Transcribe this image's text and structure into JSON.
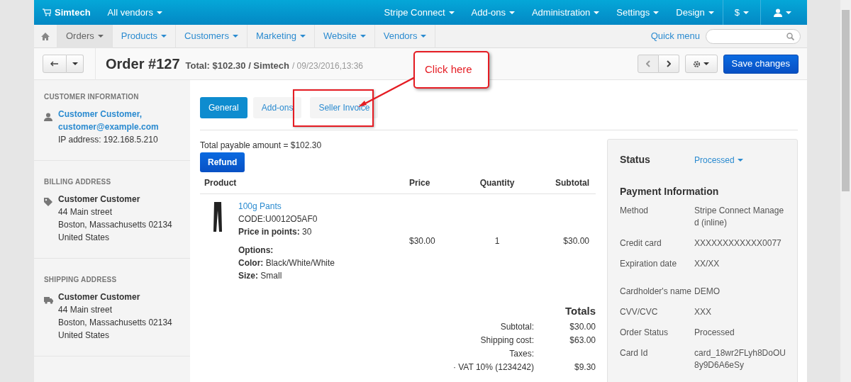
{
  "topbar": {
    "brand": "Simtech",
    "vendor_menu": "All vendors",
    "menus": [
      {
        "label": "Stripe Connect"
      },
      {
        "label": "Add-ons"
      },
      {
        "label": "Administration"
      },
      {
        "label": "Settings"
      },
      {
        "label": "Design"
      },
      {
        "label": "$",
        "kind": "boxed"
      }
    ]
  },
  "subnav": {
    "items": [
      {
        "label": "Orders",
        "selected": true
      },
      {
        "label": "Products",
        "selected": false
      },
      {
        "label": "Customers",
        "selected": false
      },
      {
        "label": "Marketing",
        "selected": false
      },
      {
        "label": "Website",
        "selected": false
      },
      {
        "label": "Vendors",
        "selected": false
      }
    ],
    "quick_menu": "Quick menu"
  },
  "toolbar": {
    "title": "Order #127",
    "summary": "Total: $102.30 / Simtech",
    "date": "/ 09/23/2016,13:36",
    "save": "Save changes"
  },
  "sidebar": [
    {
      "heading": "CUSTOMER INFORMATION",
      "kind": "person",
      "lines": [
        {
          "text": "Customer Customer,",
          "kind": "link"
        },
        {
          "text": "customer@example.com",
          "kind": "link"
        },
        {
          "text": "IP address: 192.168.5.210",
          "kind": "plain"
        }
      ]
    },
    {
      "heading": "BILLING ADDRESS",
      "kind": "tag",
      "lines": [
        {
          "text": "Customer Customer",
          "kind": "bold"
        },
        {
          "text": "44 Main street",
          "kind": "plain"
        },
        {
          "text": "Boston, Massachusetts 02134",
          "kind": "plain"
        },
        {
          "text": "United States",
          "kind": "plain"
        }
      ]
    },
    {
      "heading": "SHIPPING ADDRESS",
      "kind": "truck",
      "lines": [
        {
          "text": "Customer Customer",
          "kind": "bold"
        },
        {
          "text": "44 Main street",
          "kind": "plain"
        },
        {
          "text": "Boston, Massachusetts 02134",
          "kind": "plain"
        },
        {
          "text": "United States",
          "kind": "plain"
        }
      ]
    }
  ],
  "tabs": [
    {
      "label": "General",
      "selected": true
    },
    {
      "label": "Add-ons",
      "selected": false
    },
    {
      "label": "Seller Invoice",
      "selected": false
    }
  ],
  "total_payable": "Total payable amount = $102.30",
  "refund": "Refund",
  "table": {
    "columns": [
      "Product",
      "Price",
      "Quantity",
      "Subtotal"
    ],
    "rows": [
      {
        "name": "100g Pants",
        "code": "CODE:U0012O5AF0",
        "points": "**Price in points:** 30",
        "options_heading": "Options:",
        "options": [
          "**Color:** Black/White/White",
          "**Size:** Small"
        ],
        "price": "$30.00",
        "quantity": "1",
        "subtotal": "$30.00"
      }
    ]
  },
  "totals": {
    "heading": "Totals",
    "rows": [
      {
        "label": "Subtotal:",
        "value": "$30.00"
      },
      {
        "label": "Shipping cost:",
        "value": "$63.00"
      },
      {
        "label": "Taxes:",
        "value": ""
      },
      {
        "label": "· VAT 10% (1234242)",
        "value": "$9.30"
      }
    ]
  },
  "status_panel": {
    "status_label": "Status",
    "status_value": "Processed",
    "payment_heading": "Payment Information",
    "fields": [
      {
        "label": "Method",
        "value": "Stripe Connect Managed (inline)"
      },
      {
        "label": "Credit card",
        "value": "XXXXXXXXXXXX0077"
      },
      {
        "label": "Expiration date",
        "value": "XX/XX"
      },
      {
        "label": "Cardholder's name",
        "value": "DEMO"
      },
      {
        "label": "CVV/CVC",
        "value": "XXX"
      },
      {
        "label": "Order Status",
        "value": "Processed"
      },
      {
        "label": "Card Id",
        "value": "card_18wr2FLyh8DoOU8y9D6A6eSy"
      }
    ]
  },
  "annotation": {
    "callout": "Click here"
  }
}
